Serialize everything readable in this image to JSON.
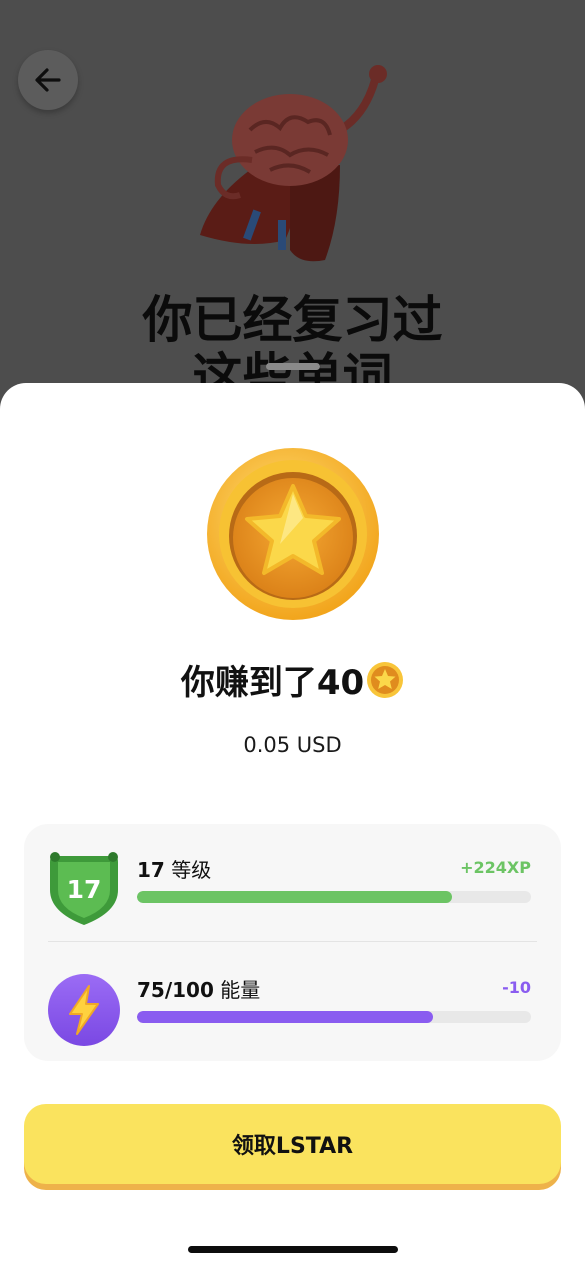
{
  "background": {
    "title_line1": "你已经复习过",
    "title_line2": "这些单词",
    "back_icon": "arrow-left-icon",
    "mascot_icon": "superhero-brain-icon"
  },
  "reward": {
    "coin_icon": "star-coin-icon",
    "earned_text": "你赚到了40",
    "usd_value": "0.05 USD"
  },
  "stats": {
    "level": {
      "badge_value": "17",
      "label_number": "17",
      "label_text": "等级",
      "delta": "+224XP",
      "progress": 0.8,
      "color": "#6cc464"
    },
    "energy": {
      "icon": "lightning-icon",
      "label_number": "75/100",
      "label_text": "能量",
      "delta": "-10",
      "progress": 0.75,
      "color": "#8a5cf0"
    }
  },
  "claim_button": {
    "label": "领取LSTAR",
    "color": "#fae35e"
  }
}
